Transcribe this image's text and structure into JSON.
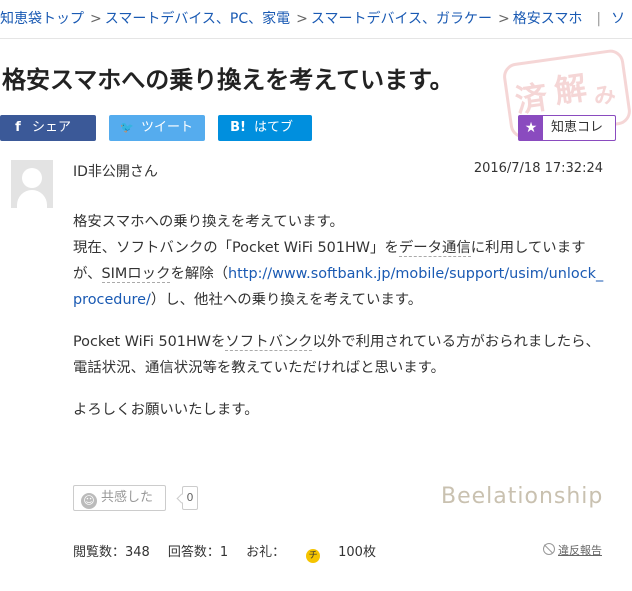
{
  "breadcrumb": {
    "items": [
      "知恵袋トップ",
      "スマートデバイス、PC、家電",
      "スマートデバイス、ガラケー",
      "格安スマホ"
    ],
    "separator": ">",
    "overflow": "ソ"
  },
  "question": {
    "title": "格安スマホへの乗り換えを考えています。",
    "stamp_chars": [
      "済",
      "解",
      "み"
    ],
    "asker": "ID非公開さん",
    "datetime": "2016/7/18  17:32:24",
    "body": {
      "p1_line1": "格安スマホへの乗り換えを考えています。",
      "p1_line2a": "現在、ソフトバンクの「Pocket WiFi 501HW」を",
      "p1_line2b": "データ通信",
      "p1_line2c": "に利用していますが、",
      "p1_line2d": "SIMロック",
      "p1_line2e": "を解除（",
      "p1_link": "http://www.softbank.jp/mobile/support/usim/unlock_procedure/",
      "p1_line2f": "）し、他社への乗り換えを考えています。",
      "p2a": "Pocket WiFi 501HWを",
      "p2b": "ソフトバンク",
      "p2c": "以外で利用されている方がおられましたら、電話状況、通信状況等を教えていただければと思います。",
      "p3": "よろしくお願いいたします。"
    }
  },
  "share": {
    "facebook_icon": "f",
    "facebook": "シェア",
    "twitter_icon": "🐦",
    "twitter": "ツイート",
    "hatena_icon": "B!",
    "hatena": "はてブ",
    "chie_icon": "★",
    "chie": "知恵コレ"
  },
  "reaction": {
    "empathy_icon": "☺",
    "empathy_label": "共感した",
    "empathy_count": "0",
    "brand": "Beelationship"
  },
  "stats": {
    "views": "閲覧数：348",
    "answers": "回答数：1",
    "reward_label": "お礼：",
    "reward_coin": "チ",
    "reward_value": "100枚",
    "report": "違反報告"
  },
  "colors": {
    "link": "#1a5ab3",
    "facebook": "#3b5998",
    "twitter": "#55acee",
    "hatena": "#008fde",
    "chie": "#8a4bbf",
    "coin": "#f5c400"
  }
}
